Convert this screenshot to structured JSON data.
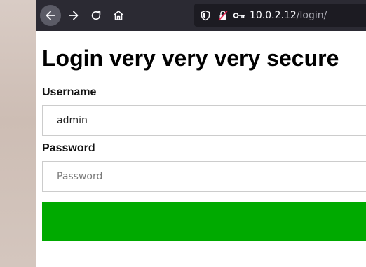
{
  "browser": {
    "url_host": "10.0.2.12",
    "url_path": "/login/",
    "icons": {
      "back": "arrow-left-icon",
      "forward": "arrow-right-icon",
      "reload": "reload-icon",
      "home": "home-icon",
      "tracking_protection": "shield-icon",
      "insecure_connection": "lock-strikethrough-icon",
      "saved_logins": "key-icon"
    }
  },
  "page": {
    "title": "Login very very very secure",
    "username_label": "Username",
    "username_value": "admin",
    "password_label": "Password",
    "password_placeholder": "Password",
    "submit_label": ""
  },
  "colors": {
    "toolbar": "#2b2a33",
    "urlbar": "#1c1b22",
    "submit_button": "#00aa00",
    "insecure_icon": "#e22850"
  }
}
